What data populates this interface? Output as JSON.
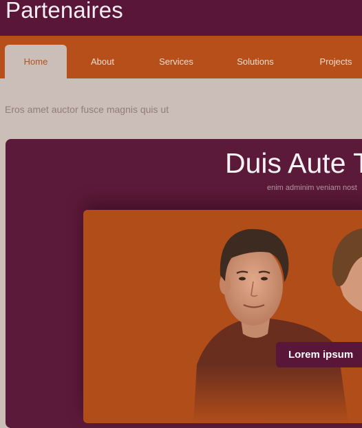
{
  "header": {
    "title": "Partenaires"
  },
  "nav": {
    "items": [
      {
        "label": "Home"
      },
      {
        "label": "About"
      },
      {
        "label": "Services"
      },
      {
        "label": "Solutions"
      },
      {
        "label": "Projects"
      }
    ]
  },
  "tagline": "Eros amet auctor fusce magnis quis ut",
  "feature": {
    "title": "Duis Aute T",
    "subtitle": "enim adminim veniam nost",
    "cta_label": "Lorem ipsum"
  },
  "colors": {
    "header_bg": "#5a1638",
    "nav_bg": "#b64f19",
    "page_bg": "#cbbdb7",
    "panel_bg": "#5c1a3a",
    "slide_bg": "#b14d19",
    "active_nav_text": "#b0541f"
  }
}
